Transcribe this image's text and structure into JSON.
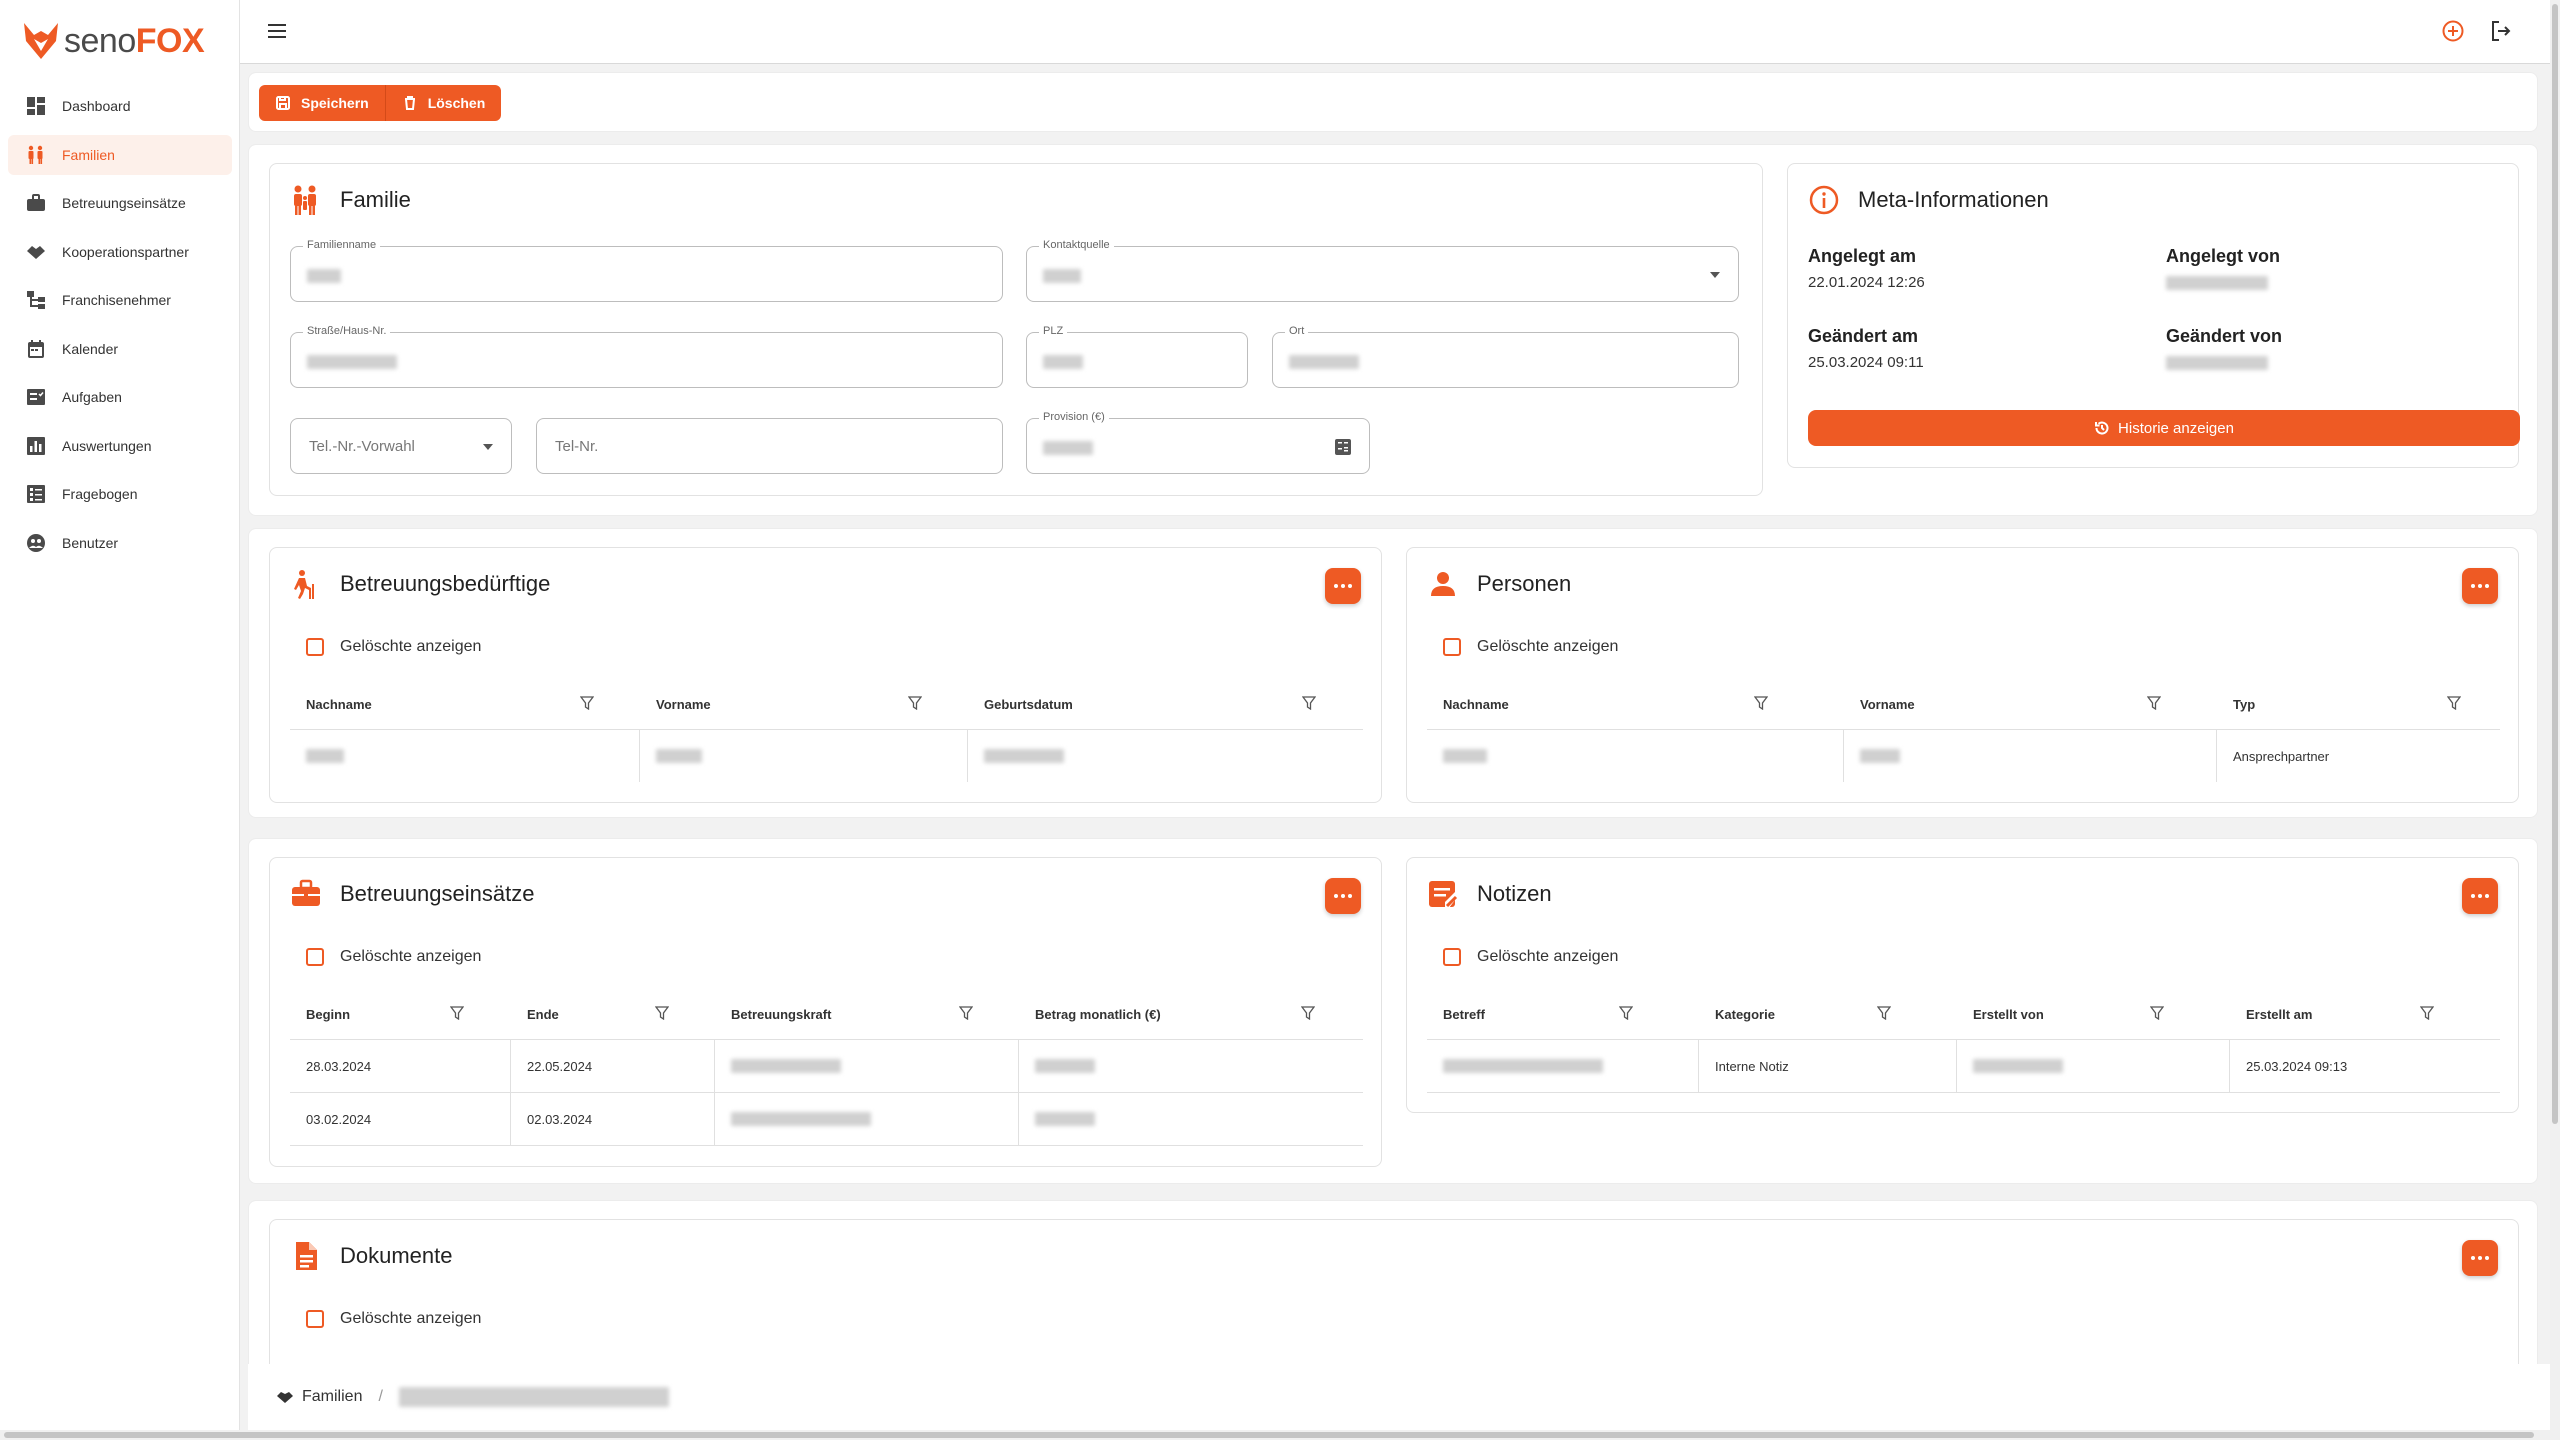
{
  "app": {
    "logo_main": "seno",
    "logo_accent": "FOX",
    "accent_color": "#ee5a24"
  },
  "sidebar": {
    "items": [
      {
        "label": "Dashboard",
        "icon": "dashboard-icon"
      },
      {
        "label": "Familien",
        "icon": "family-icon",
        "active": true
      },
      {
        "label": "Betreuungseinsätze",
        "icon": "briefcase-icon"
      },
      {
        "label": "Kooperationspartner",
        "icon": "handshake-icon"
      },
      {
        "label": "Franchisenehmer",
        "icon": "hierarchy-icon"
      },
      {
        "label": "Kalender",
        "icon": "calendar-icon"
      },
      {
        "label": "Aufgaben",
        "icon": "tasks-icon"
      },
      {
        "label": "Auswertungen",
        "icon": "chart-icon"
      },
      {
        "label": "Fragebogen",
        "icon": "form-icon"
      },
      {
        "label": "Benutzer",
        "icon": "users-icon"
      }
    ]
  },
  "toolbar": {
    "save_label": "Speichern",
    "delete_label": "Löschen"
  },
  "familie": {
    "title": "Familie",
    "fields": {
      "familienname_label": "Familienname",
      "kontaktquelle_label": "Kontaktquelle",
      "strasse_label": "Straße/Haus-Nr.",
      "plz_label": "PLZ",
      "ort_label": "Ort",
      "tel_vorwahl_placeholder": "Tel.-Nr.-Vorwahl",
      "tel_nr_placeholder": "Tel-Nr.",
      "provision_label": "Provision (€)"
    }
  },
  "meta": {
    "title": "Meta-Informationen",
    "angelegt_am_label": "Angelegt am",
    "angelegt_am_value": "22.01.2024 12:26",
    "angelegt_von_label": "Angelegt von",
    "geaendert_am_label": "Geändert am",
    "geaendert_am_value": "25.03.2024 09:11",
    "geaendert_von_label": "Geändert von",
    "history_button": "Historie anzeigen"
  },
  "deleted_toggle_label": "Gelöschte anzeigen",
  "betreuungsbeduerftige": {
    "title": "Betreuungsbedürftige",
    "columns": [
      "Nachname",
      "Vorname",
      "Geburtsdatum"
    ]
  },
  "personen": {
    "title": "Personen",
    "columns": [
      "Nachname",
      "Vorname",
      "Typ"
    ],
    "rows": [
      {
        "typ": "Ansprechpartner"
      }
    ]
  },
  "betreuungseinsaetze": {
    "title": "Betreuungseinsätze",
    "columns": [
      "Beginn",
      "Ende",
      "Betreuungskraft",
      "Betrag monatlich (€)"
    ],
    "rows": [
      {
        "beginn": "28.03.2024",
        "ende": "22.05.2024"
      },
      {
        "beginn": "03.02.2024",
        "ende": "02.03.2024"
      }
    ]
  },
  "notizen": {
    "title": "Notizen",
    "columns": [
      "Betreff",
      "Kategorie",
      "Erstellt von",
      "Erstellt am"
    ],
    "rows": [
      {
        "kategorie": "Interne Notiz",
        "erstellt_am": "25.03.2024 09:13"
      }
    ]
  },
  "dokumente": {
    "title": "Dokumente"
  },
  "breadcrumb": {
    "root": "Familien",
    "separator": "/"
  }
}
